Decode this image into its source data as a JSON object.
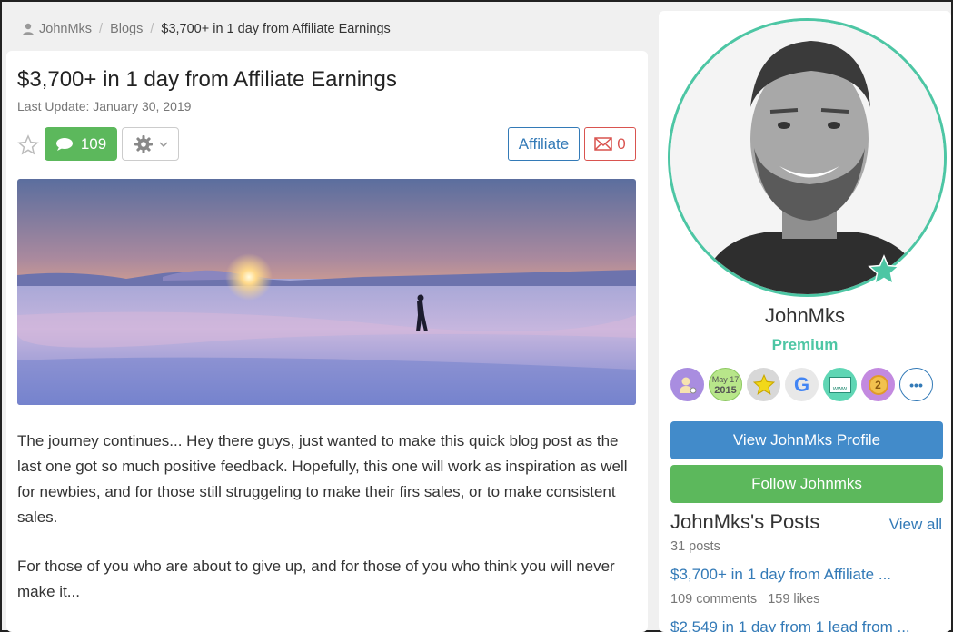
{
  "breadcrumb": {
    "user": "JohnMks",
    "section": "Blogs",
    "current": "$3,700+ in 1 day from Affiliate Earnings",
    "separator": "/"
  },
  "article": {
    "title": "$3,700+ in 1 day from Affiliate Earnings",
    "last_update": "Last Update: January 30, 2019",
    "comment_count": "109",
    "tag_label": "Affiliate",
    "report_count": "0",
    "paragraphs": [
      "The journey continues... Hey there guys, just wanted to make this quick blog post as the last one got so much positive feedback. Hopefully, this one will work as inspiration as well for newbies, and for those still struggeling to make their firs sales, or to make consistent sales.",
      "For those of you who are about to give up, and for those of you who think you will never make it..."
    ]
  },
  "sidebar": {
    "username": "JohnMks",
    "rank": "Premium",
    "badges": [
      {
        "icon": "user-gear-badge-icon",
        "text": ""
      },
      {
        "icon": "date-badge-icon",
        "text": "May 17",
        "text2": "2015"
      },
      {
        "icon": "star-badge-icon",
        "text": ""
      },
      {
        "icon": "google-badge-icon",
        "text": "G"
      },
      {
        "icon": "website-badge-icon",
        "text": "www"
      },
      {
        "icon": "rank-2-badge-icon",
        "text": "2"
      },
      {
        "icon": "more-badges-icon",
        "text": "•••"
      }
    ],
    "profile_button": "View JohnMks Profile",
    "follow_button": "Follow Johnmks",
    "posts_heading": "JohnMks's Posts",
    "view_all": "View all",
    "posts_count": "31 posts",
    "posts": [
      {
        "title": "$3,700+ in 1 day from Affiliate ...",
        "comments": "109 comments",
        "likes": "159 likes"
      },
      {
        "title": "$2,549 in 1 day from 1 lead from ...",
        "comments": "",
        "likes": ""
      }
    ]
  },
  "colors": {
    "green": "#5cb85c",
    "blue": "#428bca",
    "link": "#337ab7",
    "teal": "#4dc6a4",
    "red": "#d9534f"
  }
}
